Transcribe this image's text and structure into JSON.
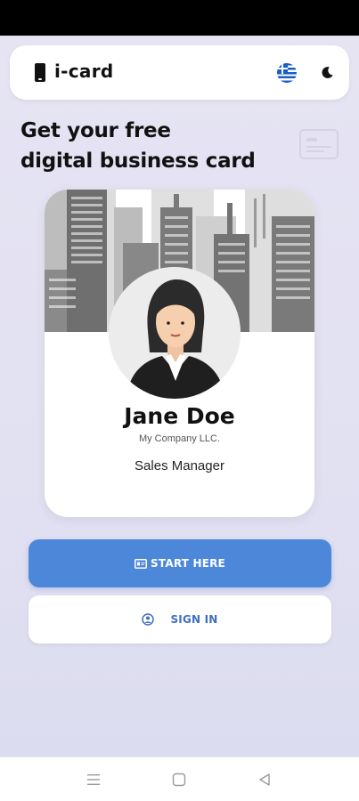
{
  "header": {
    "app_name": "i-card",
    "logo_icon": "phone-icon",
    "language_icon": "greece-flag-icon",
    "theme_icon": "moon-icon"
  },
  "hero": {
    "line1": "Get your free",
    "line2": "digital business card",
    "decor_icon": "id-card-icon"
  },
  "sample_card": {
    "name": "Jane Doe",
    "company": "My Company LLC.",
    "title": "Sales Manager"
  },
  "actions": {
    "start_label": "START HERE",
    "signin_label": "SIGN IN"
  },
  "navigation": {
    "items": [
      "menu-icon",
      "home-square-icon",
      "back-triangle-icon"
    ]
  },
  "colors": {
    "primary": "#4d87da",
    "link": "#3d6fc4",
    "background": "#e4e3f3"
  }
}
